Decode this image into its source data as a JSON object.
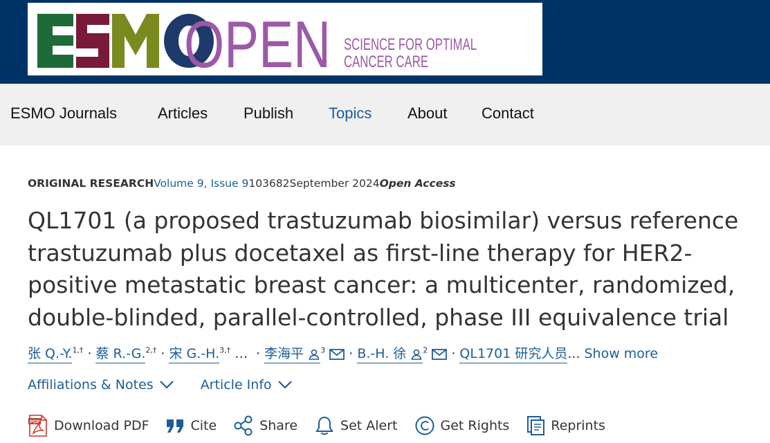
{
  "header": {
    "logo_text_esmo": "ESMO",
    "logo_text_open": "OPEN",
    "logo_tagline_1": "SCIENCE FOR OPTIMAL",
    "logo_tagline_2": "CANCER CARE",
    "colors": {
      "band": "#003365",
      "esmo_green": "#1e6b3a",
      "esmo_red": "#7a1a3a",
      "esmo_olive": "#7a8a1f",
      "esmo_navy": "#1d3a6b",
      "open_purple": "#9b59a8"
    }
  },
  "nav": {
    "items": [
      "ESMO Journals",
      "Articles",
      "Publish",
      "Topics",
      "About",
      "Contact"
    ],
    "active": "Topics"
  },
  "article": {
    "type": "ORIGINAL RESEARCH",
    "volume": "Volume 9, Issue 9",
    "article_number": "103682",
    "date": "September 2024",
    "access": "Open Access",
    "title": "QL1701 (a proposed trastuzumab biosimilar) versus reference trastuzumab plus docetaxel as first-line therapy for HER2-positive metastatic breast cancer: a multicenter, randomized, double-blinded, parallel-controlled, phase III equivalence trial"
  },
  "authors": {
    "list": [
      {
        "name": "张 Q.-Y.",
        "sup": "1,†"
      },
      {
        "name": "蔡 R.-G.",
        "sup": "2,†"
      },
      {
        "name": "宋 G.-H.",
        "sup": "3,†"
      }
    ],
    "ellipsis": "…",
    "corresponding_1": {
      "name": "李海平",
      "sup": "3"
    },
    "corresponding_2": {
      "name": "B.-H. 徐",
      "sup": "2"
    },
    "group": "QL1701 研究人员",
    "group_ellipsis": "...",
    "show_more": "Show more"
  },
  "panels": {
    "affiliations": "Affiliations & Notes",
    "article_info": "Article Info"
  },
  "actions": {
    "download_pdf": "Download PDF",
    "cite": "Cite",
    "share": "Share",
    "set_alert": "Set Alert",
    "get_rights": "Get Rights",
    "reprints": "Reprints"
  }
}
